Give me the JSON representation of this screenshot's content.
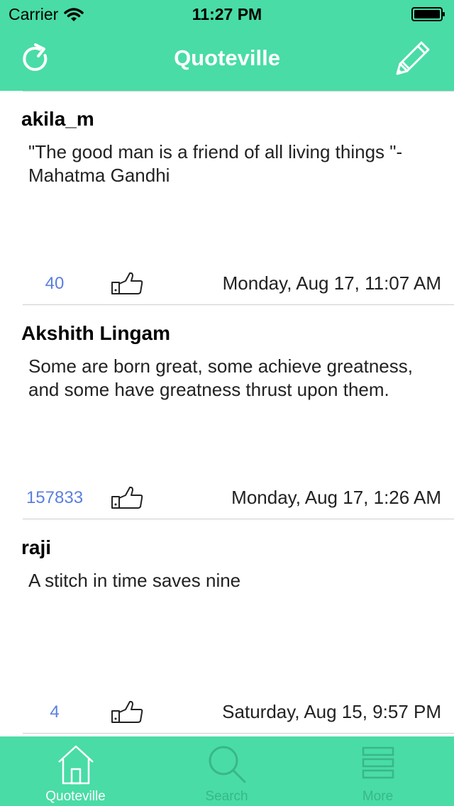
{
  "status_bar": {
    "carrier": "Carrier",
    "time": "11:27 PM"
  },
  "nav": {
    "title": "Quoteville",
    "left_icon": "refresh-icon",
    "right_icon": "pencil-icon"
  },
  "posts": [
    {
      "author": "akila_m",
      "quote": "\"The good man is a friend of all living things \"- Mahatma Gandhi",
      "likes": "40",
      "date": "Monday, Aug 17, 11:07 AM"
    },
    {
      "author": "Akshith Lingam",
      "quote": "Some are born great, some achieve greatness, and some have greatness thrust upon them.",
      "likes": "157833",
      "date": "Monday, Aug 17, 1:26 AM"
    },
    {
      "author": "raji",
      "quote": "A stitch in time saves nine",
      "likes": "4",
      "date": "Saturday, Aug 15, 9:57 PM"
    }
  ],
  "tabs": [
    {
      "label": "Quoteville",
      "icon": "home-icon",
      "selected": true
    },
    {
      "label": "Search",
      "icon": "search-icon",
      "selected": false
    },
    {
      "label": "More",
      "icon": "menu-lines-icon",
      "selected": false
    }
  ],
  "colors": {
    "accent": "#49dca6",
    "likes_text": "#5b7fdf",
    "inactive_tab": "#39b787"
  }
}
